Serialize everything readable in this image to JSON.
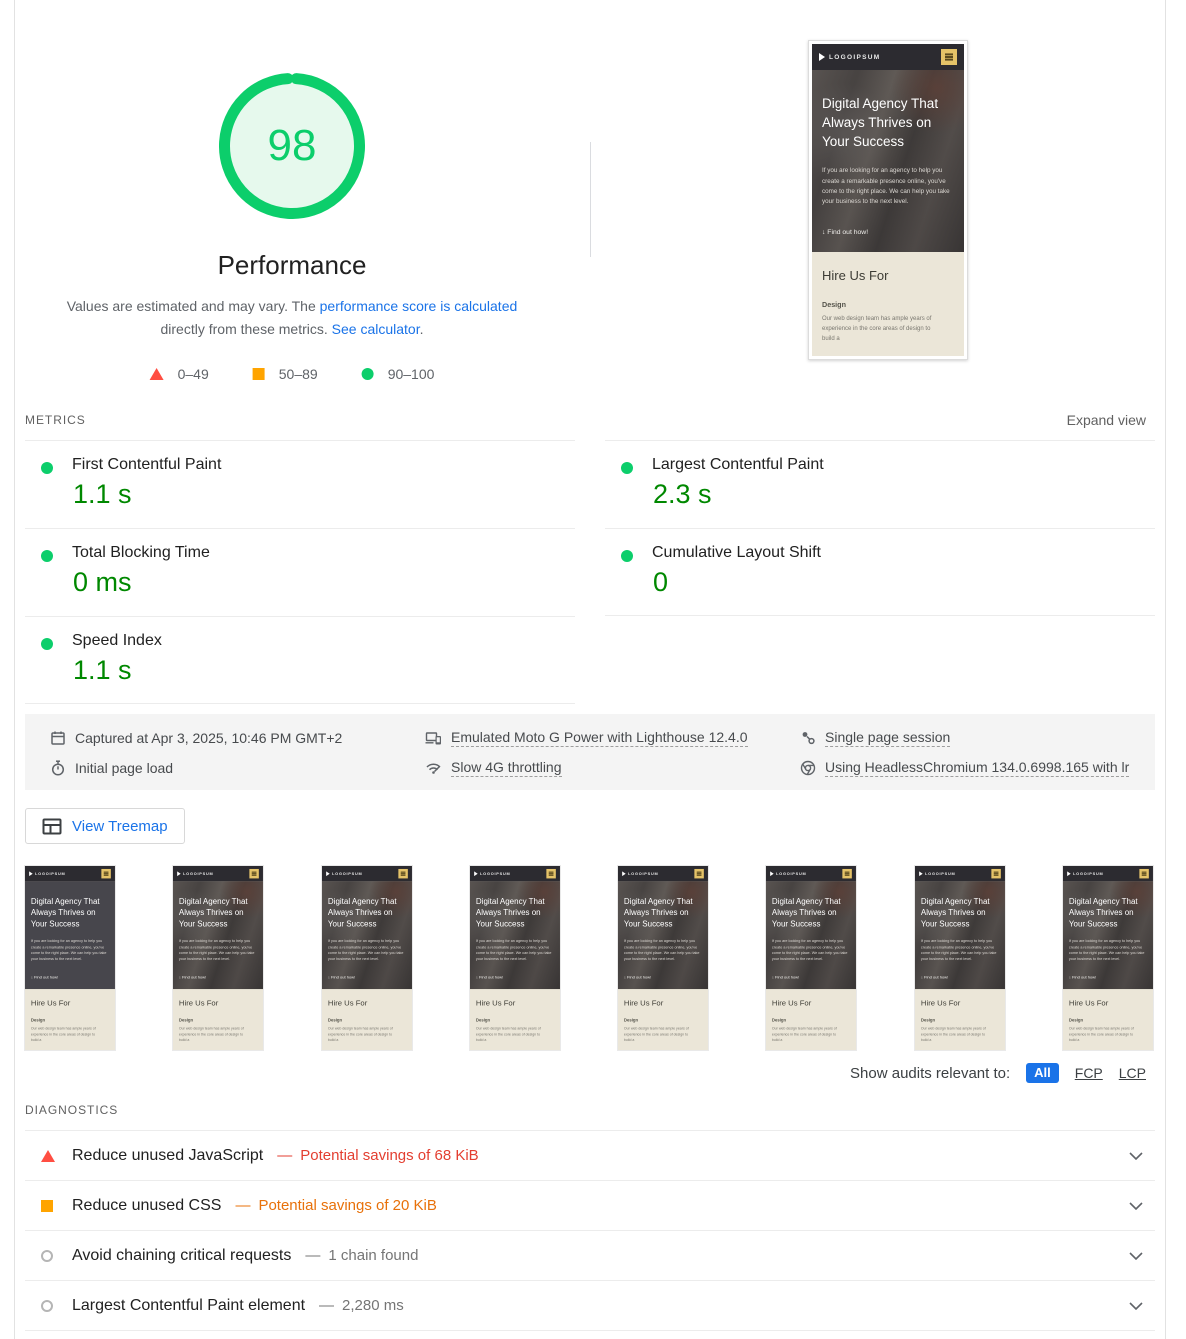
{
  "score_section": {
    "score": "98",
    "title": "Performance",
    "description": {
      "part1": "Values are estimated and may vary. The ",
      "link1": "performance score is calculated",
      "part2": " directly from these metrics. ",
      "link2": "See calculator",
      "part3": "."
    },
    "legend": [
      {
        "icon": "fail-triangle-icon",
        "label": "0–49"
      },
      {
        "icon": "average-square-icon",
        "label": "50–89"
      },
      {
        "icon": "pass-circle-icon",
        "label": "90–100"
      }
    ]
  },
  "metrics_section": {
    "heading": "METRICS",
    "expand_label": "Expand view",
    "items": [
      {
        "name": "First Contentful Paint",
        "value": "1.1 s",
        "status": "pass"
      },
      {
        "name": "Largest Contentful Paint",
        "value": "2.3 s",
        "status": "pass"
      },
      {
        "name": "Total Blocking Time",
        "value": "0 ms",
        "status": "pass"
      },
      {
        "name": "Cumulative Layout Shift",
        "value": "0",
        "status": "pass"
      },
      {
        "name": "Speed Index",
        "value": "1.1 s",
        "status": "pass"
      }
    ]
  },
  "environment": {
    "captured": "Captured at Apr 3, 2025, 10:46 PM GMT+2",
    "initial_load": "Initial page load",
    "emulation": "Emulated Moto G Power with Lighthouse 12.4.0",
    "throttling": "Slow 4G throttling",
    "session": "Single page session",
    "chromium": "Using HeadlessChromium 134.0.6998.165 with lr"
  },
  "treemap_button": {
    "label": "View Treemap"
  },
  "filmstrip": {
    "frame_count": 8
  },
  "audit_filter": {
    "label": "Show audits relevant to:",
    "all": "All",
    "fcp": "FCP",
    "lcp": "LCP"
  },
  "diagnostics_section": {
    "heading": "DIAGNOSTICS",
    "separator": "—",
    "items": [
      {
        "severity": "fail",
        "title": "Reduce unused JavaScript",
        "detail": "Potential savings of 68 KiB"
      },
      {
        "severity": "average",
        "title": "Reduce unused CSS",
        "detail": "Potential savings of 20 KiB"
      },
      {
        "severity": "info",
        "title": "Avoid chaining critical requests",
        "detail": "1 chain found"
      },
      {
        "severity": "info",
        "title": "Largest Contentful Paint element",
        "detail": "2,280 ms"
      }
    ]
  },
  "page_preview": {
    "logo": "LOGOIPSUM",
    "headline": "Digital Agency That Always Thrives on Your Success",
    "paragraph": "If you are looking for an agency to help you create a remarkable presence online, you've come to the right place. We can help you take your business to the next level.",
    "cta": "↓  Find out how!",
    "section_title": "Hire Us For",
    "subheading": "Design",
    "body_text": "Our web design team has ample years of experience in the core areas of design to build a"
  },
  "colors": {
    "pass_green": "#0cce6b",
    "metric_value_green": "#008800",
    "average_orange": "#ffa400",
    "fail_red": "#ff4e42",
    "savings_red": "#e33e30",
    "savings_orange": "#e8710a",
    "link_blue": "#1a73e8",
    "env_bar_gray": "#f4f4f4"
  }
}
